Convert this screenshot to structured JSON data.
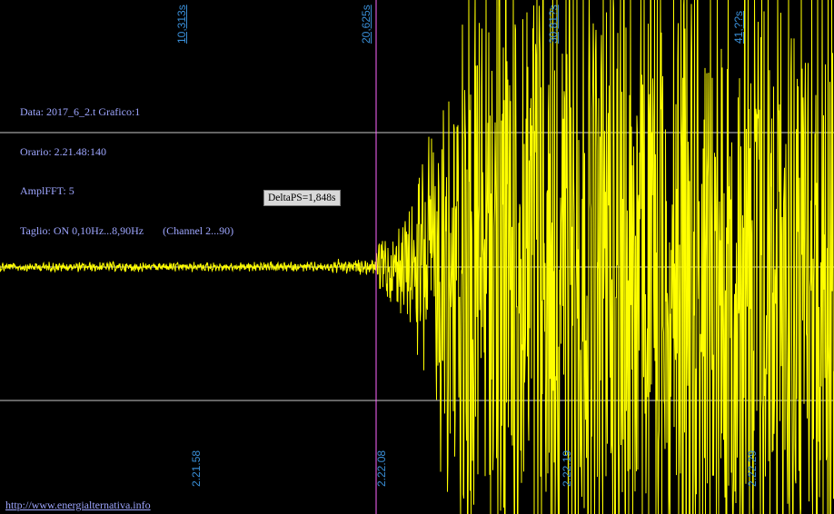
{
  "chart_data": {
    "type": "line",
    "series": [
      {
        "name": "",
        "color": "#ffff00",
        "onset_time_s": 20.625
      }
    ],
    "markers": [
      {
        "label": "10,313s",
        "time_s": 10.313
      },
      {
        "label": "20,625s",
        "time_s": 20.625
      },
      {
        "label": "30,81?s",
        "time_s": 30.81
      },
      {
        "label": "41,??s",
        "time_s": 41.0
      }
    ],
    "clock_ticks": [
      "2.21.58",
      "2.22.08",
      "2.22.19",
      "2.22.29"
    ],
    "annotation": "DeltaPS=1,848s",
    "grid": true
  },
  "info": {
    "line1": "Data: 2017_6_2.t Grafico:1",
    "line2": "Orario: 2.21.48:140",
    "line3": "AmplFFT: 5",
    "line4": "Taglio: ON 0,10Hz...8,90Hz       (Channel 2...90)"
  },
  "footer": "http://www.energialternativa.info",
  "colors": {
    "background": "#000000",
    "signal": "#ffff00",
    "grid": "#c8c8c8",
    "marker": "#ff66ff",
    "label": "#3a8fd8",
    "info_text": "#9ea6ff"
  }
}
